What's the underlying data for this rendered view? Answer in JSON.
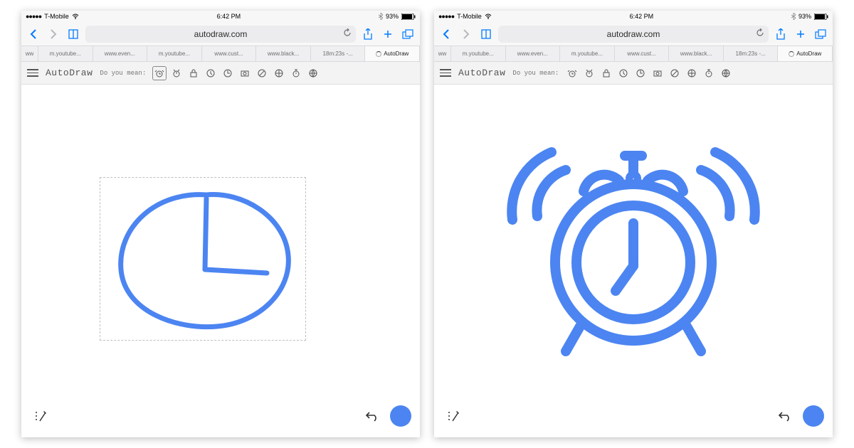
{
  "status": {
    "signal_dots": "●●●●●",
    "carrier": "T-Mobile",
    "time": "6:42 PM",
    "battery_pct": "93%"
  },
  "nav": {
    "url": "autodraw.com"
  },
  "tabs": {
    "items": [
      "ww",
      "m.youtube...",
      "www.even...",
      "m.youtube...",
      "www.cust...",
      "www.black...",
      "18m:23s -...",
      "AutoDraw"
    ]
  },
  "app": {
    "title": "AutoDraw",
    "prompt": "Do you mean:"
  },
  "suggestions": {
    "names": [
      "alarm-clock-icon",
      "alarm-clock-alt-icon",
      "lock-icon",
      "clock-icon",
      "clock-alt-icon",
      "camera-icon",
      "compass-icon",
      "crosshair-icon",
      "stopwatch-icon",
      "globe-icon"
    ]
  },
  "colors": {
    "accent": "#4c85f1",
    "ios_blue": "#007aff"
  },
  "left_pane": {
    "selected_suggestion_index": 0,
    "has_selection_box": true
  },
  "right_pane": {
    "selected_suggestion_index": -1,
    "has_selection_box": false
  }
}
